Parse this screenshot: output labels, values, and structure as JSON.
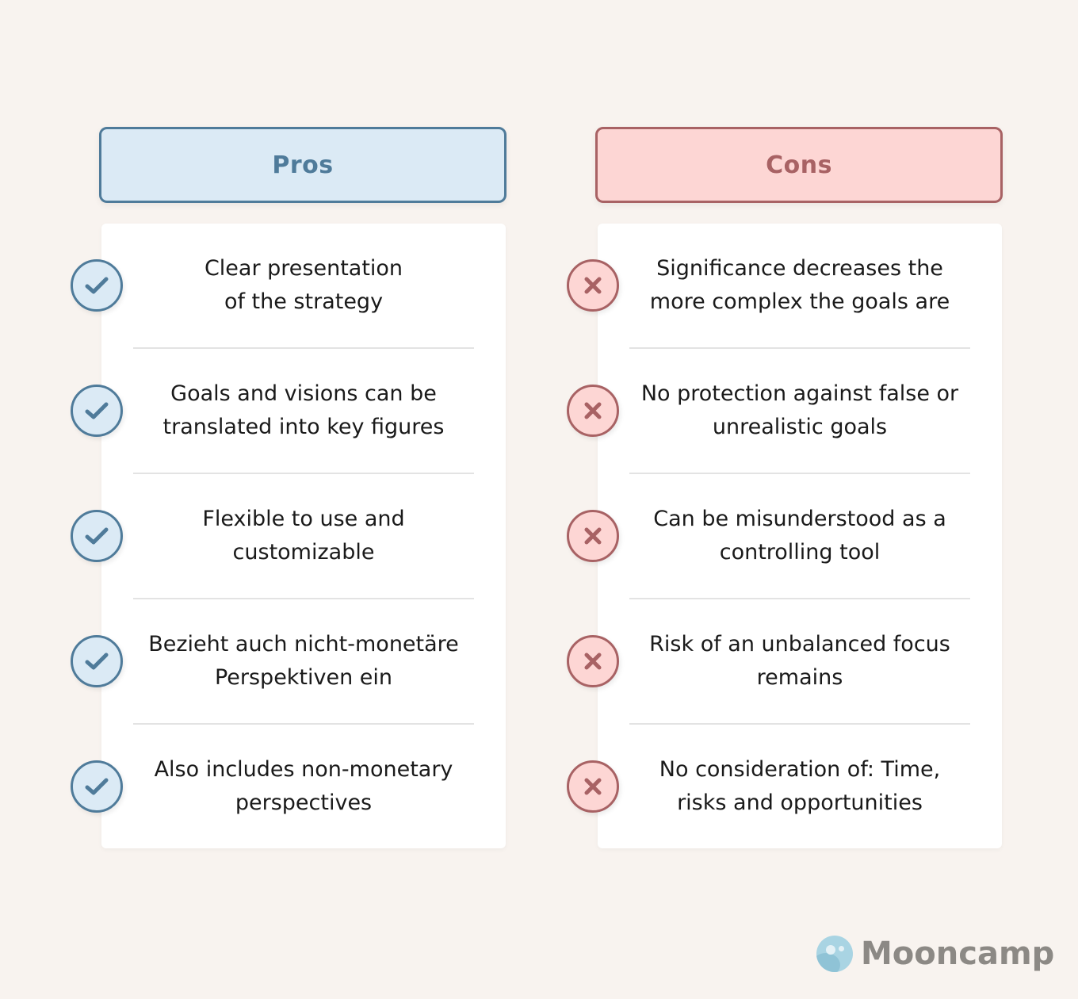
{
  "pros": {
    "title": "Pros",
    "icon": "check-icon",
    "color": "#4f7b9a",
    "fill": "#dbeaf5",
    "items": [
      {
        "text": "Clear presentation\nof the strategy"
      },
      {
        "text": "Goals and visions can be\ntranslated into key figures"
      },
      {
        "text": "Flexible to use and\ncustomizable"
      },
      {
        "text": "Bezieht auch nicht-monetäre\nPerspektiven ein"
      },
      {
        "text": "Also includes non-monetary\nperspectives"
      }
    ]
  },
  "cons": {
    "title": "Cons",
    "icon": "x-icon",
    "color": "#a86264",
    "fill": "#fdd6d4",
    "items": [
      {
        "text": "Significance decreases the\nmore complex the goals are"
      },
      {
        "text": "No protection against false or\nunrealistic goals"
      },
      {
        "text": "Can be misunderstood as a\ncontrolling tool"
      },
      {
        "text": "Risk of an unbalanced focus\nremains"
      },
      {
        "text": "No consideration of: Time,\nrisks and opportunities"
      }
    ]
  },
  "brand": {
    "name": "Mooncamp",
    "icon": "moon-logo-icon"
  }
}
